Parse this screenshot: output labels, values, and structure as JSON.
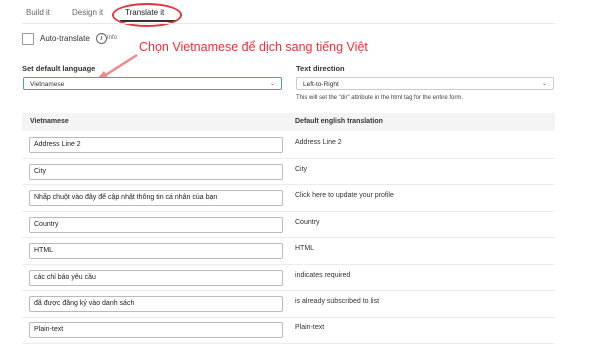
{
  "tabs": [
    {
      "label": "Build it"
    },
    {
      "label": "Design it"
    },
    {
      "label": "Translate it"
    }
  ],
  "auto_translate": {
    "label": "Auto-translate",
    "checked": false,
    "info_label": "Info"
  },
  "annotation": "Chọn Vietnamese để dịch sang tiếng Việt",
  "default_language": {
    "label": "Set default language",
    "value": "Vietnamese"
  },
  "text_direction": {
    "label": "Text direction",
    "value": "Left-to-Right",
    "hint": "This will set the \"dir\" attribute in the html tag for the entire form."
  },
  "table": {
    "headers": [
      "Vietnamese",
      "Default english translation"
    ],
    "rows": [
      {
        "vi": "Address Line 2",
        "en": "Address Line 2"
      },
      {
        "vi": "City",
        "en": "City"
      },
      {
        "vi": "Nhấp chuột vào đây để cập nhật thông tin cá nhân của bạn",
        "en": "Click here to update your profile"
      },
      {
        "vi": "Country",
        "en": "Country"
      },
      {
        "vi": "HTML",
        "en": "HTML"
      },
      {
        "vi": "các chỉ báo yêu cầu",
        "en": "indicates required"
      },
      {
        "vi": "đã được đăng ký vào danh sách",
        "en": "is already subscribed to list"
      },
      {
        "vi": "Plain-text",
        "en": "Plain-text"
      }
    ]
  },
  "colors": {
    "annotation": "#e8323b",
    "focus_border": "#4aa3a3"
  }
}
